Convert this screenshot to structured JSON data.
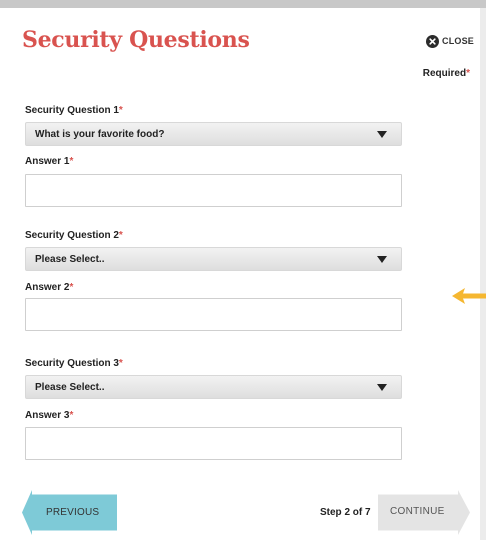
{
  "dialog": {
    "title": "Security Questions",
    "close_label": "CLOSE",
    "required_label": "Required",
    "required_marker": "*"
  },
  "questions": [
    {
      "question_label": "Security Question 1",
      "selected_value": "What is your favorite food?",
      "answer_label": "Answer 1",
      "answer_value": ""
    },
    {
      "question_label": "Security Question 2",
      "selected_value": "Please Select..",
      "answer_label": "Answer 2",
      "answer_value": ""
    },
    {
      "question_label": "Security Question 3",
      "selected_value": "Please Select..",
      "answer_label": "Answer 3",
      "answer_value": ""
    }
  ],
  "footer": {
    "previous_label": "PREVIOUS",
    "step_text": "Step 2 of 7",
    "continue_label": "CONTINUE"
  },
  "icons": {
    "close": "close-circle-icon",
    "dropdown": "chevron-down-icon",
    "pointer": "arrow-left-icon"
  },
  "colors": {
    "title": "#d9534f",
    "required_marker": "#d9534f",
    "previous_button": "#7ecad7",
    "continue_button": "#e4e4e4",
    "pointer_arrow": "#f5b731"
  }
}
